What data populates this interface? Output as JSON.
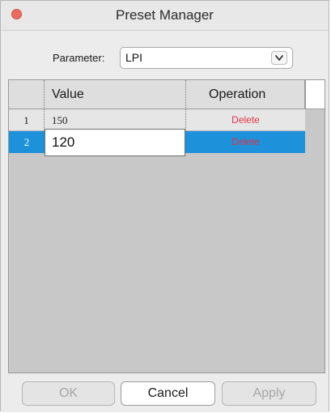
{
  "window": {
    "title": "Preset Manager"
  },
  "parameter": {
    "label": "Parameter:",
    "selected": "LPI"
  },
  "table": {
    "columns": [
      "Value",
      "Operation"
    ],
    "rows": [
      {
        "index": "1",
        "value": "150",
        "operation": "Delete"
      },
      {
        "index": "2",
        "value": "120",
        "operation": "Delete"
      }
    ]
  },
  "buttons": {
    "ok": "OK",
    "cancel": "Cancel",
    "apply": "Apply"
  },
  "colors": {
    "selection": "#1e91db",
    "delete_text": "#e0344a",
    "close_button": "#ed6a5e"
  },
  "icons": {
    "close": "close-icon",
    "select_chevron": "chevron-down-icon"
  }
}
